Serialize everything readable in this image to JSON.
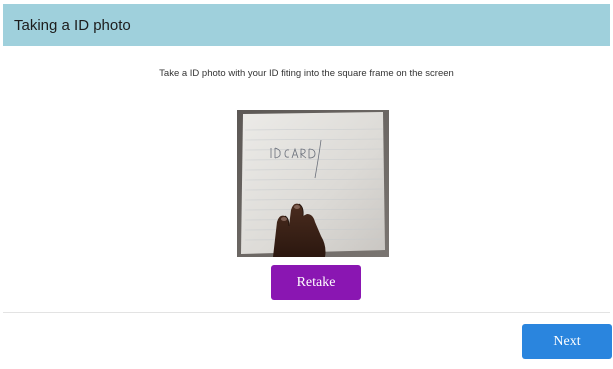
{
  "header": {
    "title": "Taking a ID photo",
    "background_color": "#9fd0dc"
  },
  "instruction": {
    "text": "Take a ID photo with your ID fiting into the square frame on the screen"
  },
  "photo": {
    "handwritten_text": "ID CARD",
    "icon": "captured-id-photo"
  },
  "actions": {
    "retake_label": "Retake",
    "retake_color": "#8a16b2",
    "next_label": "Next",
    "next_color": "#2a85de"
  }
}
